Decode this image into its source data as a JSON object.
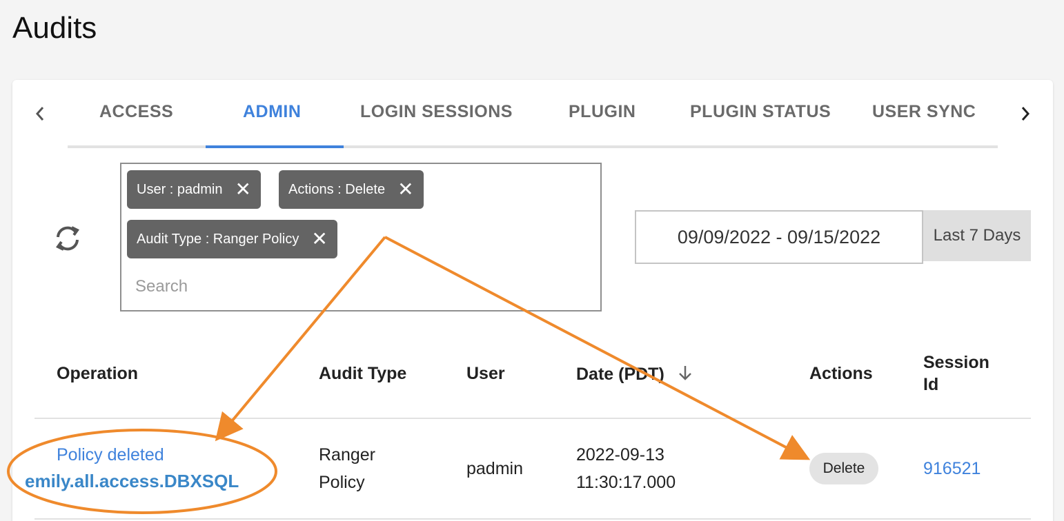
{
  "page": {
    "title": "Audits"
  },
  "tabs": [
    {
      "label": "ACCESS",
      "active": false
    },
    {
      "label": "ADMIN",
      "active": true
    },
    {
      "label": "LOGIN SESSIONS",
      "active": false
    },
    {
      "label": "PLUGIN",
      "active": false
    },
    {
      "label": "PLUGIN STATUS",
      "active": false
    },
    {
      "label": "USER SYNC",
      "active": false
    }
  ],
  "tab_nav": {
    "prev_icon": "chevron-left-icon",
    "next_icon": "chevron-right-icon"
  },
  "filters": {
    "chips": [
      {
        "label": "User : padmin"
      },
      {
        "label": "Actions : Delete"
      },
      {
        "label": "Audit Type : Ranger Policy"
      }
    ],
    "search_placeholder": "Search"
  },
  "date_filter": {
    "range": "09/09/2022 - 09/15/2022",
    "preset": "Last 7 Days"
  },
  "table": {
    "columns": [
      "Operation",
      "Audit Type",
      "User",
      "Date (PDT)",
      "Actions",
      "Session",
      "Id"
    ],
    "rows": [
      {
        "operation_line1": "Policy deleted",
        "operation_line2": "emily.all.access.DBXSQL",
        "audit_type_line1": "Ranger",
        "audit_type_line2": "Policy",
        "user": "padmin",
        "date_line1": "2022-09-13",
        "date_line2": "11:30:17.000",
        "action": "Delete",
        "session_id": "916521"
      }
    ]
  },
  "colors": {
    "accent": "#3f82dc",
    "chip": "#646464",
    "annotation": "#ef8a2c"
  }
}
